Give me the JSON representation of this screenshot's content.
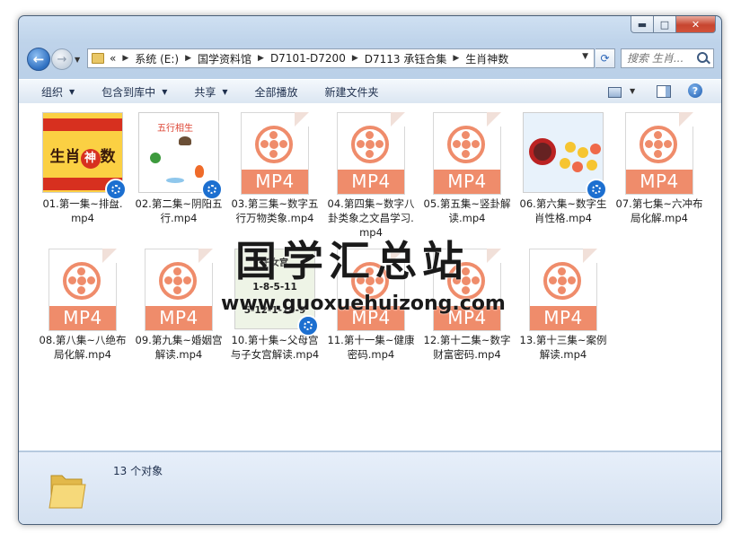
{
  "window": {
    "controls": {
      "min": "▬",
      "max": "□",
      "close": "✕"
    }
  },
  "nav": {
    "back_glyph": "←",
    "forward_glyph": "→",
    "breadcrumbs": [
      "«",
      "系统 (E:)",
      "国学资料馆",
      "D7101-D7200",
      "D7113 承钰合集",
      "生肖神数"
    ],
    "search_placeholder": "搜索 生肖..."
  },
  "toolbar": {
    "organize": "组织",
    "include": "包含到库中",
    "share": "共享",
    "play_all": "全部播放",
    "new_folder": "新建文件夹",
    "help": "?"
  },
  "files": [
    {
      "name": "01.第一集~排盘.mp4",
      "kind": "pic1"
    },
    {
      "name": "02.第二集~阴阳五行.mp4",
      "kind": "pic2"
    },
    {
      "name": "03.第三集~数字五行万物类象.mp4",
      "kind": "doc"
    },
    {
      "name": "04.第四集~数字八卦类象之文昌学习.mp4",
      "kind": "doc"
    },
    {
      "name": "05.第五集~竖卦解读.mp4",
      "kind": "doc"
    },
    {
      "name": "06.第六集~数字生肖性格.mp4",
      "kind": "pic6"
    },
    {
      "name": "07.第七集~六冲布局化解.mp4",
      "kind": "doc"
    },
    {
      "name": "08.第八集~八绝布局化解.mp4",
      "kind": "doc"
    },
    {
      "name": "09.第九集~婚姻宫解读.mp4",
      "kind": "doc"
    },
    {
      "name": "10.第十集~父母宫与子女宫解读.mp4",
      "kind": "pic10"
    },
    {
      "name": "11.第十一集~健康密码.mp4",
      "kind": "doc"
    },
    {
      "name": "12.第十二集~数字财富密码.mp4",
      "kind": "doc"
    },
    {
      "name": "13.第十三集~案例解读.mp4",
      "kind": "doc"
    }
  ],
  "thumb_text": {
    "mp4": "MP4",
    "pic1": {
      "left": "生肖",
      "mid": "神",
      "right": "数"
    },
    "pic2": {
      "title": "五行相生"
    },
    "pic10": {
      "title": "子女宫",
      "line1": "1-8-5-11",
      "line2": "5-12-1-10-9"
    }
  },
  "watermark": {
    "title": "国学汇总站",
    "url": "www.guoxuehuizong.com"
  },
  "status": {
    "count": "13 个对象"
  }
}
